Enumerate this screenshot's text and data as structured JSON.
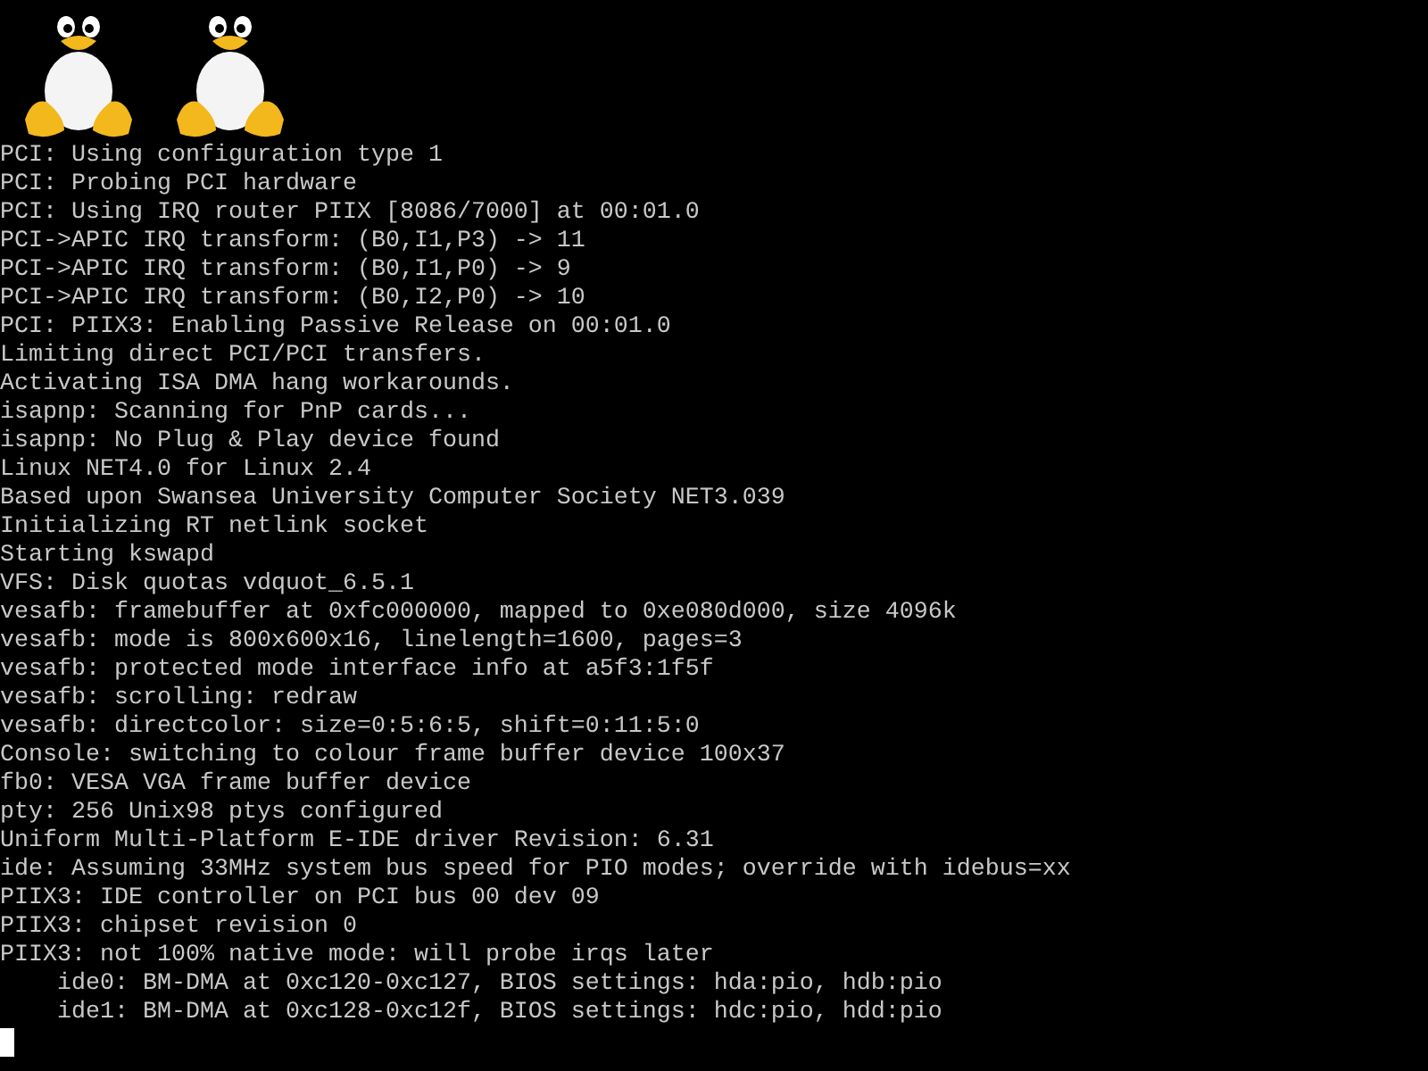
{
  "console": {
    "lines": [
      "PCI: Using configuration type 1",
      "PCI: Probing PCI hardware",
      "PCI: Using IRQ router PIIX [8086/7000] at 00:01.0",
      "PCI->APIC IRQ transform: (B0,I1,P3) -> 11",
      "PCI->APIC IRQ transform: (B0,I1,P0) -> 9",
      "PCI->APIC IRQ transform: (B0,I2,P0) -> 10",
      "PCI: PIIX3: Enabling Passive Release on 00:01.0",
      "Limiting direct PCI/PCI transfers.",
      "Activating ISA DMA hang workarounds.",
      "isapnp: Scanning for PnP cards...",
      "isapnp: No Plug & Play device found",
      "Linux NET4.0 for Linux 2.4",
      "Based upon Swansea University Computer Society NET3.039",
      "Initializing RT netlink socket",
      "Starting kswapd",
      "VFS: Disk quotas vdquot_6.5.1",
      "vesafb: framebuffer at 0xfc000000, mapped to 0xe080d000, size 4096k",
      "vesafb: mode is 800x600x16, linelength=1600, pages=3",
      "vesafb: protected mode interface info at a5f3:1f5f",
      "vesafb: scrolling: redraw",
      "vesafb: directcolor: size=0:5:6:5, shift=0:11:5:0",
      "Console: switching to colour frame buffer device 100x37",
      "fb0: VESA VGA frame buffer device",
      "pty: 256 Unix98 ptys configured",
      "Uniform Multi-Platform E-IDE driver Revision: 6.31",
      "ide: Assuming 33MHz system bus speed for PIO modes; override with idebus=xx",
      "PIIX3: IDE controller on PCI bus 00 dev 09",
      "PIIX3: chipset revision 0",
      "PIIX3: not 100% native mode: will probe irqs later",
      "    ide0: BM-DMA at 0xc120-0xc127, BIOS settings: hda:pio, hdb:pio",
      "    ide1: BM-DMA at 0xc128-0xc12f, BIOS settings: hdc:pio, hdd:pio"
    ]
  }
}
